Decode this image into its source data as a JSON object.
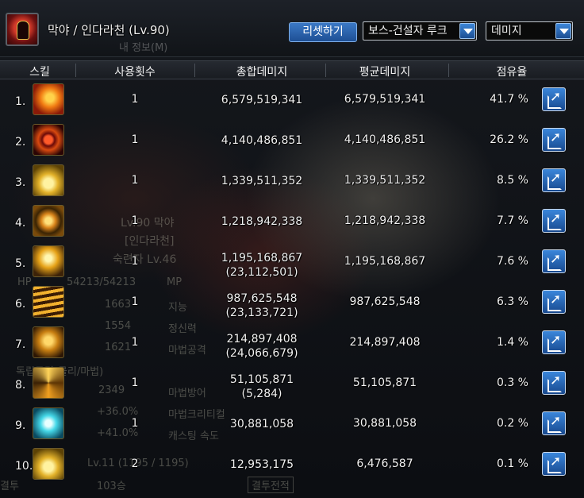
{
  "header": {
    "character_name": "막야 / 인다라천 (Lv.90)",
    "subtitle_ghost": "내 정보(M)",
    "reset_label": "리셋하기",
    "boss_select_value": "보스-건설자 루크",
    "metric_select_value": "데미지"
  },
  "columns": {
    "skill": "스킬",
    "uses": "사용횟수",
    "total": "총합데미지",
    "avg": "평균데미지",
    "share": "점유율"
  },
  "rows": [
    {
      "rank": "1.",
      "icon": "fire-burst-skill-icon",
      "uses": "1",
      "total": "6,579,519,341",
      "total_sub": "",
      "avg": "6,579,519,341",
      "share": "41.7 %"
    },
    {
      "rank": "2.",
      "icon": "eye-orb-skill-icon",
      "uses": "1",
      "total": "4,140,486,851",
      "total_sub": "",
      "avg": "4,140,486,851",
      "share": "26.2 %"
    },
    {
      "rank": "3.",
      "icon": "golden-crown-skill-icon",
      "uses": "1",
      "total": "1,339,511,352",
      "total_sub": "",
      "avg": "1,339,511,352",
      "share": "8.5 %"
    },
    {
      "rank": "4.",
      "icon": "storm-sphere-skill-icon",
      "uses": "1",
      "total": "1,218,942,338",
      "total_sub": "",
      "avg": "1,218,942,338",
      "share": "7.7 %"
    },
    {
      "rank": "5.",
      "icon": "lightning-bolt-skill-icon",
      "uses": "1",
      "total": "1,195,168,867",
      "total_sub": "(23,112,501)",
      "avg": "1,195,168,867",
      "share": "7.6 %"
    },
    {
      "rank": "6.",
      "icon": "flame-wave-skill-icon",
      "uses": "1",
      "total": "987,625,548",
      "total_sub": "(23,133,721)",
      "avg": "987,625,548",
      "share": "6.3 %"
    },
    {
      "rank": "7.",
      "icon": "caster-figure-skill-icon",
      "uses": "1",
      "total": "214,897,408",
      "total_sub": "(24,066,679)",
      "avg": "214,897,408",
      "share": "1.4 %"
    },
    {
      "rank": "8.",
      "icon": "vortex-skill-icon",
      "uses": "1",
      "total": "51,105,871",
      "total_sub": "(5,284)",
      "avg": "51,105,871",
      "share": "0.3 %"
    },
    {
      "rank": "9.",
      "icon": "cyan-gear-skill-icon",
      "uses": "1",
      "total": "30,881,058",
      "total_sub": "",
      "avg": "30,881,058",
      "share": "0.2 %"
    },
    {
      "rank": "10.",
      "icon": "golden-crown-skill-icon",
      "uses": "2",
      "total": "12,953,175",
      "total_sub": "",
      "avg": "6,476,587",
      "share": "0.1 %"
    }
  ],
  "background_ghost_text": {
    "hp": "HP",
    "hp_value": "54213/54213",
    "mp": "MP",
    "level_name": "Lv.90 막야",
    "job": "[인다라천]",
    "mastery": "숙련자 Lv.46",
    "intelligence": "지능",
    "spirit": "정신력",
    "magic_attack": "마법공격",
    "indep_attack": "독립공격(물리/마법)",
    "magic_defense": "마법방어",
    "magic_crit": "마법크리티컬",
    "cast_speed": "캐스팅 속도",
    "value_1663": "1663",
    "value_1554": "1554",
    "value_1621": "1621",
    "value_2349": "2349",
    "value_36": "+36.0%",
    "value_41": "+41.0%",
    "bottom_level": "Lv.11 (1195 / 1195)",
    "bottom_count": "103승",
    "bottom_btn": "결투전적",
    "bottom_left": "결투"
  },
  "colors": {
    "accent_blue": "#2f6fc0",
    "header_bg": "#1d2128",
    "text": "#f2f2f2"
  }
}
